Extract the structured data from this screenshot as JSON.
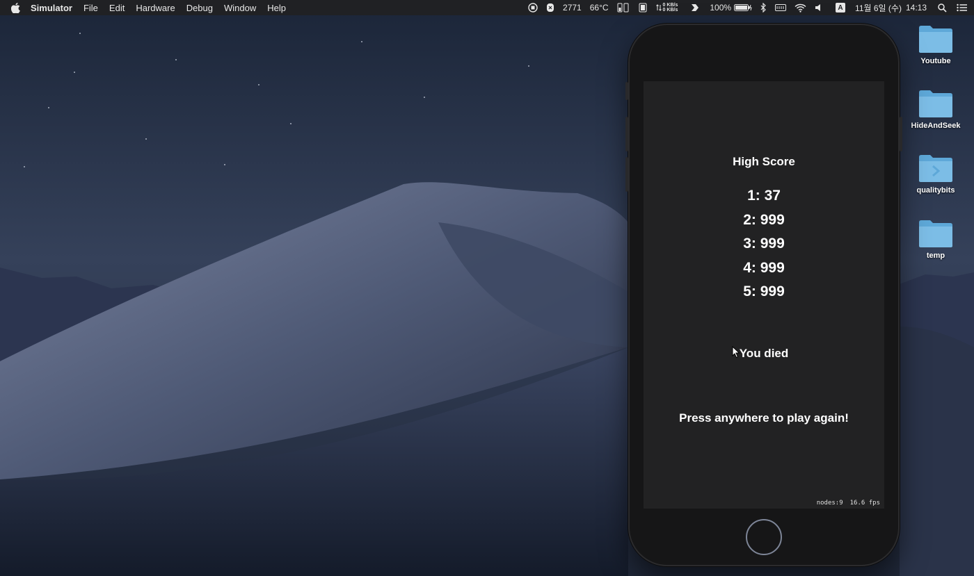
{
  "menubar": {
    "app_name": "Simulator",
    "menus": [
      "File",
      "Edit",
      "Hardware",
      "Debug",
      "Window",
      "Help"
    ],
    "status": {
      "counter": "2771",
      "temperature": "66°C",
      "net_up": "0 KB/s",
      "net_down": "0 KB/s",
      "battery": "100%",
      "input_method": "A",
      "date": "11월 6일 (수)",
      "time": "14:13"
    }
  },
  "desktop": {
    "icons": [
      {
        "label": "Youtube"
      },
      {
        "label": "HideAndSeek"
      },
      {
        "label": "qualitybits"
      },
      {
        "label": "temp"
      }
    ]
  },
  "game": {
    "high_score_title": "High Score",
    "scores": [
      "1: 37",
      "2: 999",
      "3: 999",
      "4: 999",
      "5: 999"
    ],
    "status_message": "You died",
    "prompt": "Press anywhere to play again!",
    "debug": {
      "nodes": "nodes:9",
      "fps": "16.6 fps"
    }
  },
  "colors": {
    "menubar_bg": "#202124",
    "game_bg": "#222223",
    "folder_blue": "#7cbde6"
  }
}
